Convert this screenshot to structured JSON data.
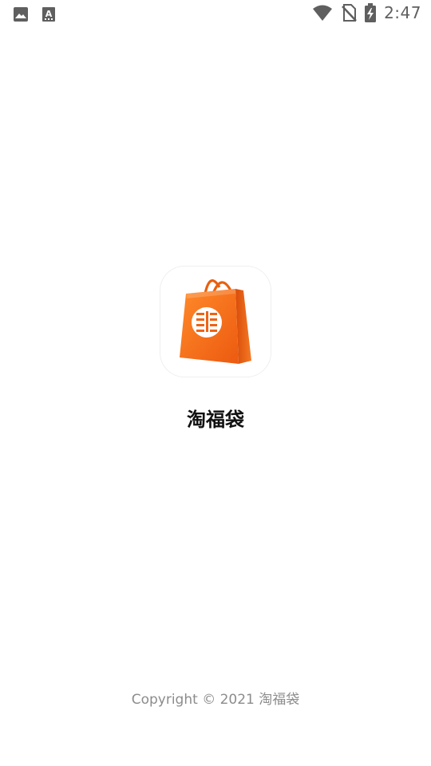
{
  "status_bar": {
    "time": "2:47",
    "left_icons": [
      "image-notification-icon",
      "font-notification-icon"
    ],
    "right_icons": [
      "wifi-icon",
      "no-sim-icon",
      "battery-charging-icon"
    ]
  },
  "splash": {
    "app_icon": "shopping-bag-logo-icon",
    "app_name": "淘福袋",
    "copyright": "Copyright © 2021 淘福袋"
  },
  "colors": {
    "background": "#ffffff",
    "bag_orange": "#f26a1b",
    "status_icons": "#5f5f5f",
    "copyright_text": "#8c8c8c"
  }
}
